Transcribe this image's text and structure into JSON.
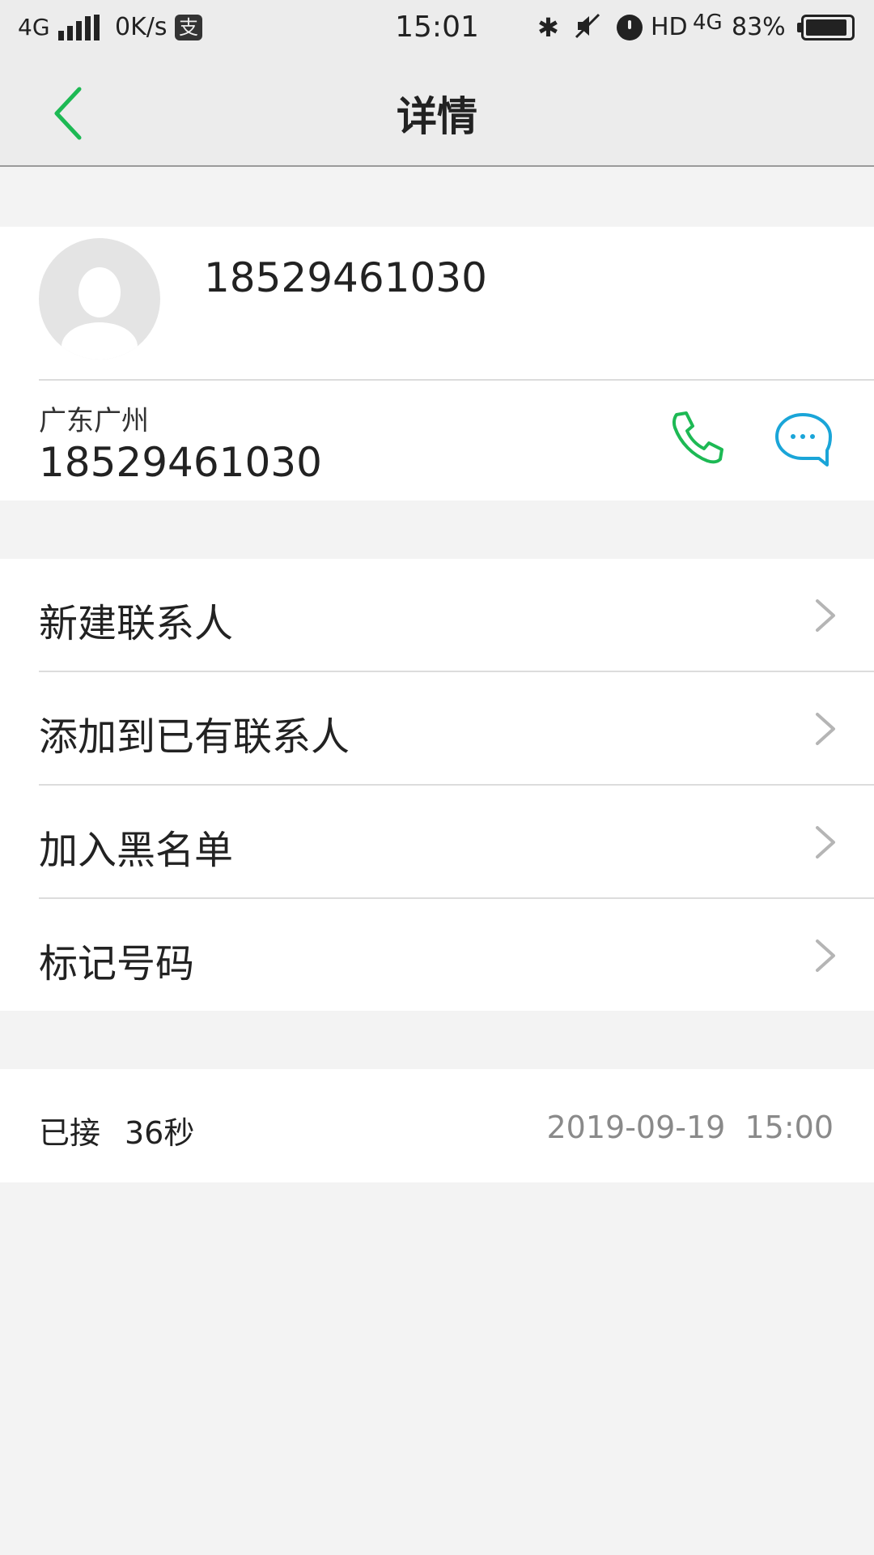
{
  "status_bar": {
    "network": "4G",
    "speed": "0K/s",
    "app_icon_char": "支",
    "time": "15:01",
    "bluetooth_glyph": "✱",
    "hd": "HD",
    "network2": "4G",
    "battery": "83%"
  },
  "header": {
    "title": "详情"
  },
  "contact": {
    "name": "18529461030",
    "location": "广东广州",
    "phone": "18529461030"
  },
  "actions": [
    {
      "label": "新建联系人"
    },
    {
      "label": "添加到已有联系人"
    },
    {
      "label": "加入黑名单"
    },
    {
      "label": "标记号码"
    }
  ],
  "call_record": {
    "status": "已接",
    "duration": "36秒",
    "datetime": "2019-09-19  15:00"
  },
  "colors": {
    "accent_green": "#1db954",
    "message_blue": "#1aa5d8",
    "background": "#f3f3f3",
    "header": "#ececec"
  },
  "icons": [
    "back-arrow-icon",
    "phone-icon",
    "message-icon",
    "chevron-right-icon",
    "avatar-placeholder-icon"
  ]
}
